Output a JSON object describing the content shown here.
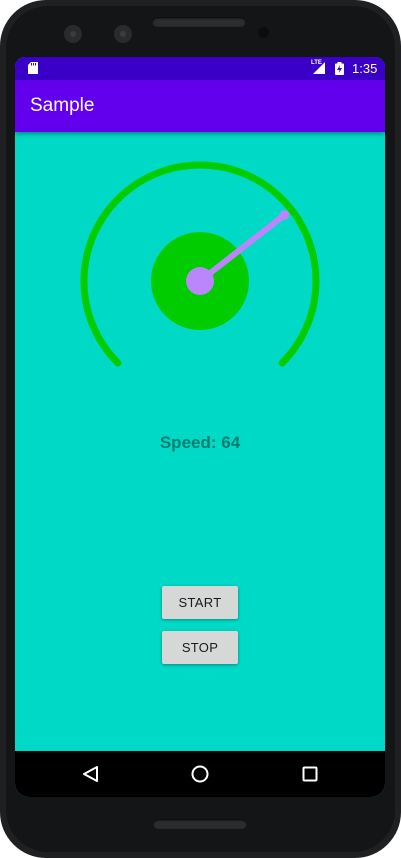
{
  "status_bar": {
    "time": "1:35",
    "network_label": "LTE",
    "icons": [
      "sd-card-icon",
      "lte-signal-icon",
      "battery-charging-icon"
    ]
  },
  "app_bar": {
    "title": "Sample"
  },
  "gauge": {
    "speed": 64,
    "ring_color": "#00cc00",
    "needle_color": "#bb86fc",
    "hub_color": "#00cc00"
  },
  "speed_display": {
    "text": "Speed: 64"
  },
  "buttons": {
    "start_label": "START",
    "stop_label": "STOP"
  },
  "nav_bar": {
    "icons": [
      "back-icon",
      "home-icon",
      "recents-icon"
    ]
  },
  "colors": {
    "status_bar": "#3a00c8",
    "app_bar": "#6200ee",
    "background": "#00d9c6",
    "speed_text": "#007d72"
  }
}
